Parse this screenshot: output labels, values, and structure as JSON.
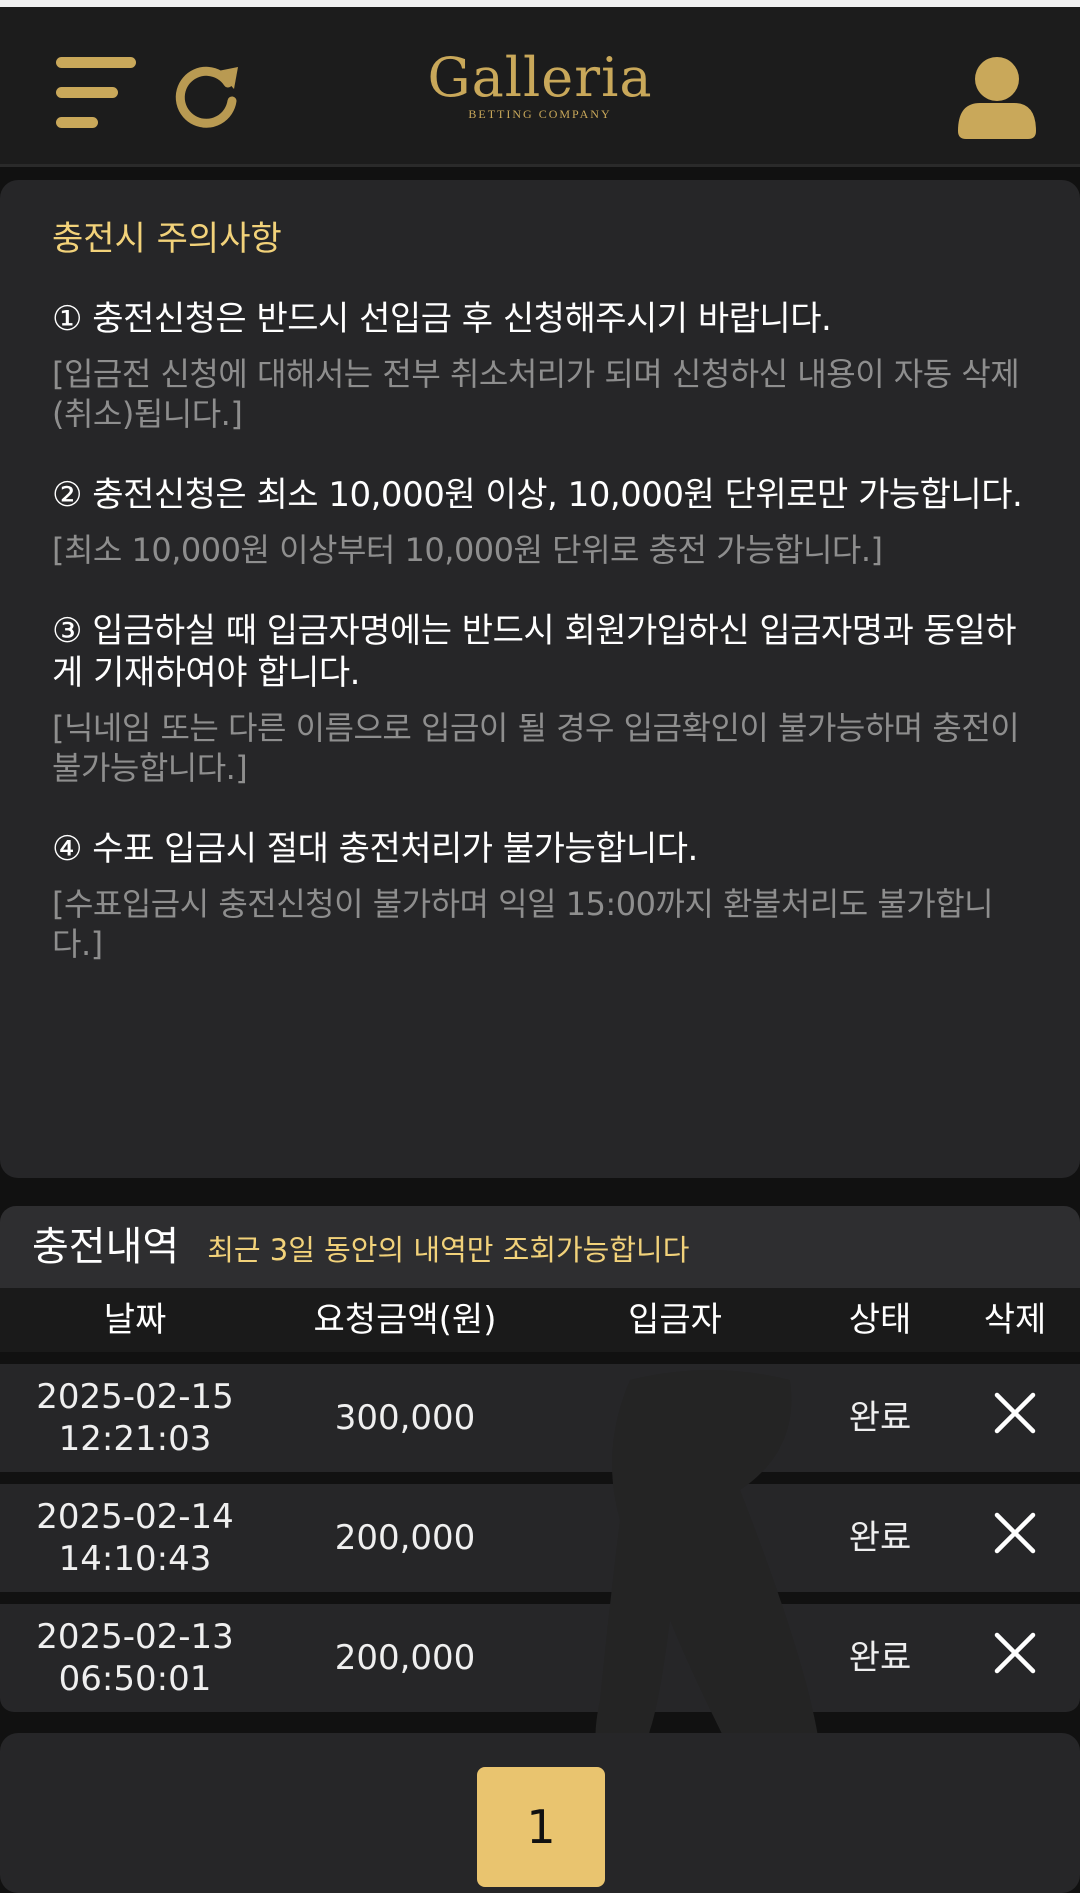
{
  "header": {
    "logo_title": "Galleria",
    "logo_subtitle": "BETTING COMPANY",
    "icons": [
      "menu-icon",
      "refresh-icon",
      "user-icon"
    ]
  },
  "notice": {
    "title": "충전시 주의사항",
    "items": [
      {
        "main": "① 충전신청은 반드시 선입금 후 신청해주시기 바랍니다.",
        "sub": "[입금전 신청에 대해서는 전부 취소처리가 되며 신청하신 내용이 자동 삭제(취소)됩니다.]"
      },
      {
        "main": "② 충전신청은 최소 10,000원 이상, 10,000원 단위로만 가능합니다.",
        "sub": "[최소 10,000원 이상부터 10,000원 단위로 충전 가능합니다.]"
      },
      {
        "main": "③ 입금하실 때 입금자명에는 반드시 회원가입하신 입금자명과 동일하게 기재하여야 합니다.",
        "sub": "[닉네임 또는 다른 이름으로 입금이 될 경우 입금확인이 불가능하며 충전이 불가능합니다.]"
      },
      {
        "main": "④ 수표 입금시 절대 충전처리가 불가능합니다.",
        "sub": "[수표입금시 충전신청이 불가하며 익일 15:00까지 환불처리도 불가합니다.]"
      }
    ]
  },
  "history": {
    "title": "충전내역",
    "note": "최근 3일 동안의 내역만 조회가능합니다",
    "columns": [
      "날짜",
      "요청금액(원)",
      "입금자",
      "상태",
      "삭제"
    ],
    "rows": [
      {
        "date": "2025-02-15",
        "time": "12:21:03",
        "amount": "300,000",
        "depositor": "",
        "status": "완료"
      },
      {
        "date": "2025-02-14",
        "time": "14:10:43",
        "amount": "200,000",
        "depositor": "",
        "status": "완료"
      },
      {
        "date": "2025-02-13",
        "time": "06:50:01",
        "amount": "200,000",
        "depositor": "",
        "status": "완료"
      }
    ]
  },
  "pagination": {
    "current_page": "1"
  },
  "colors": {
    "accent_gold": "#c9a85a",
    "highlight_yellow": "#f2d27a",
    "page_button": "#e9c46f",
    "panel": "#262628",
    "background": "#111111"
  }
}
